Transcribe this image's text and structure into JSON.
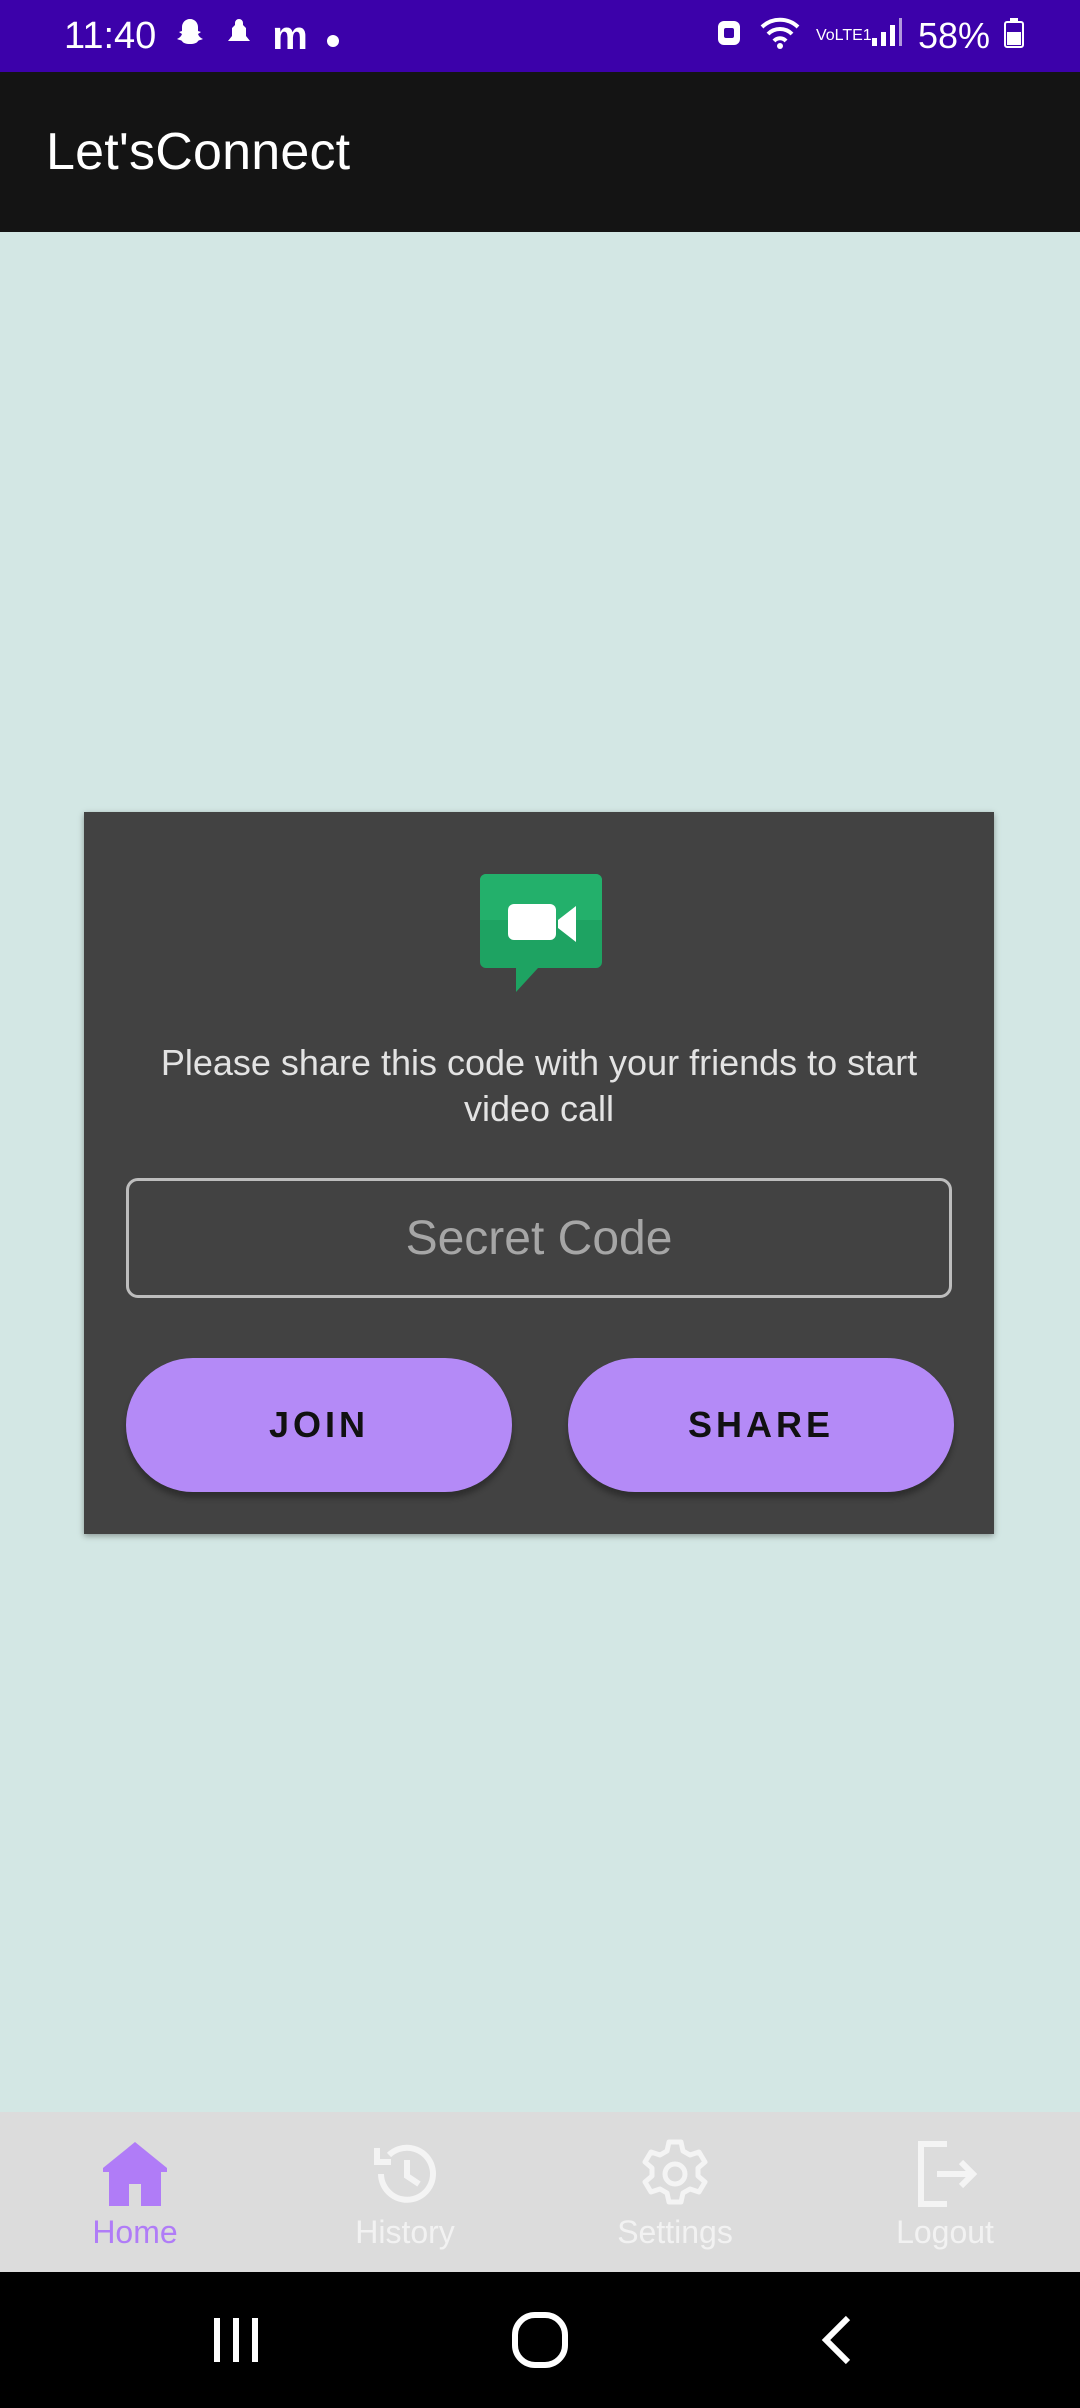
{
  "status_bar": {
    "time": "11:40",
    "notification_icons": [
      "snapchat-icon",
      "notification-icon",
      "m-app-icon",
      "dot-icon"
    ],
    "battery": "58%",
    "network_label": "VoLTE1"
  },
  "app_bar": {
    "title": "Let'sConnect"
  },
  "card": {
    "icon": "video-call-icon",
    "message": "Please share this code with your friends to start video call",
    "code_field": {
      "value": "",
      "placeholder": "Secret Code"
    },
    "join_label": "JOIN",
    "share_label": "SHARE"
  },
  "bottom_nav": {
    "items": [
      {
        "label": "Home",
        "icon": "home-icon",
        "active": true
      },
      {
        "label": "History",
        "icon": "history-icon",
        "active": false
      },
      {
        "label": "Settings",
        "icon": "gear-icon",
        "active": false
      },
      {
        "label": "Logout",
        "icon": "logout-icon",
        "active": false
      }
    ]
  },
  "system_nav": {
    "buttons": [
      "recent-apps-icon",
      "home-button-icon",
      "back-icon"
    ]
  },
  "colors": {
    "status_bar": "#3c01aa",
    "app_bar": "#141414",
    "background": "#d3e7e4",
    "card": "#424242",
    "accent": "#b48af7",
    "nav_active": "#b07cf7",
    "nav_bar": "#dcdcdc"
  }
}
